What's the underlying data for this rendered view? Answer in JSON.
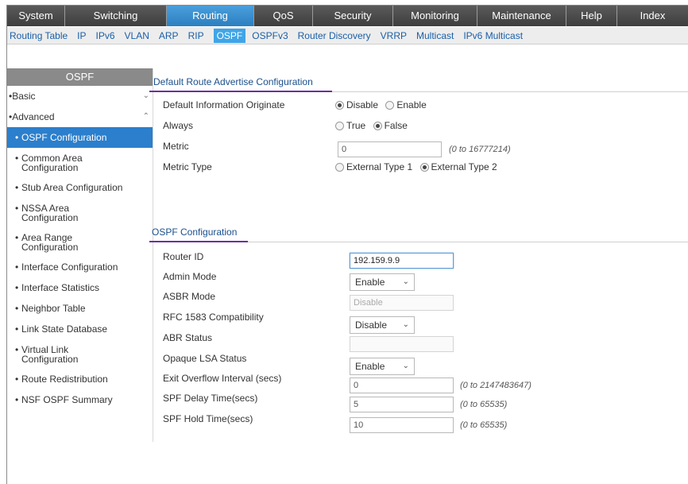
{
  "topnav": {
    "tabs": [
      {
        "label": "System",
        "active": false,
        "w": 73
      },
      {
        "label": "Switching",
        "active": false,
        "w": 128
      },
      {
        "label": "Routing",
        "active": true,
        "w": 110
      },
      {
        "label": "QoS",
        "active": false,
        "w": 74
      },
      {
        "label": "Security",
        "active": false,
        "w": 101
      },
      {
        "label": "Monitoring",
        "active": false,
        "w": 106
      },
      {
        "label": "Maintenance",
        "active": false,
        "w": 112
      },
      {
        "label": "Help",
        "active": false,
        "w": 64
      },
      {
        "label": "Index",
        "active": false,
        "w": 90
      }
    ]
  },
  "subnav": {
    "items": [
      "Routing Table",
      "IP",
      "IPv6",
      "VLAN",
      "ARP",
      "RIP",
      "OSPF",
      "OSPFv3",
      "Router Discovery",
      "VRRP",
      "Multicast",
      "IPv6 Multicast"
    ],
    "active": "OSPF"
  },
  "sidebar": {
    "header": "OSPF",
    "basic_label": "Basic",
    "advanced_label": "Advanced",
    "items": [
      {
        "label": "OSPF Configuration",
        "lines": [
          "OSPF Configuration"
        ],
        "active": true
      },
      {
        "label": "Common Area Configuration",
        "lines": [
          "Common Area",
          "Configuration"
        ],
        "active": false
      },
      {
        "label": "Stub Area Configuration",
        "lines": [
          "Stub Area Configuration"
        ],
        "active": false
      },
      {
        "label": "NSSA Area Configuration",
        "lines": [
          "NSSA Area",
          "Configuration"
        ],
        "active": false
      },
      {
        "label": "Area Range Configuration",
        "lines": [
          "Area Range",
          "Configuration"
        ],
        "active": false
      },
      {
        "label": "Interface Configuration",
        "lines": [
          "Interface Configuration"
        ],
        "active": false
      },
      {
        "label": "Interface Statistics",
        "lines": [
          "Interface Statistics"
        ],
        "active": false
      },
      {
        "label": "Neighbor Table",
        "lines": [
          "Neighbor Table"
        ],
        "active": false
      },
      {
        "label": "Link State Database",
        "lines": [
          "Link State Database"
        ],
        "active": false
      },
      {
        "label": "Virtual Link Configuration",
        "lines": [
          "Virtual Link",
          "Configuration"
        ],
        "active": false
      },
      {
        "label": "Route Redistribution",
        "lines": [
          "Route Redistribution"
        ],
        "active": false
      },
      {
        "label": "NSF OSPF Summary",
        "lines": [
          "NSF OSPF Summary"
        ],
        "active": false
      }
    ]
  },
  "default_route": {
    "title": "Default Route Advertise Configuration",
    "info_originate": {
      "label": "Default Information Originate",
      "options": [
        "Disable",
        "Enable"
      ],
      "selected": "Disable"
    },
    "always": {
      "label": "Always",
      "options": [
        "True",
        "False"
      ],
      "selected": "False"
    },
    "metric": {
      "label": "Metric",
      "value": "0",
      "range": "(0 to 16777214)"
    },
    "metric_type": {
      "label": "Metric Type",
      "options": [
        "External Type 1",
        "External Type 2"
      ],
      "selected": "External Type 2"
    }
  },
  "ospf_config": {
    "title": "OSPF Configuration",
    "router_id": {
      "label": "Router ID",
      "value": "192.159.9.9"
    },
    "admin_mode": {
      "label": "Admin Mode",
      "value": "Enable"
    },
    "asbr_mode": {
      "label": "ASBR Mode",
      "value": "Disable"
    },
    "rfc1583": {
      "label": "RFC 1583 Compatibility",
      "value": "Disable"
    },
    "abr_status": {
      "label": "ABR Status",
      "value": ""
    },
    "opaque_lsa": {
      "label": "Opaque LSA Status",
      "value": "Enable"
    },
    "exit_overflow": {
      "label": "Exit Overflow Interval (secs)",
      "value": "0",
      "range": "(0 to 2147483647)"
    },
    "spf_delay": {
      "label": "SPF Delay Time(secs)",
      "value": "5",
      "range": "(0 to 65535)"
    },
    "spf_hold": {
      "label": "SPF Hold Time(secs)",
      "value": "10",
      "range": "(0 to 65535)"
    }
  },
  "colors": {
    "active_tab": "#2c7fbf",
    "active_sub": "#3fa5e8",
    "active_side": "#2b7fcc",
    "section_line": "#6d2fa0"
  }
}
